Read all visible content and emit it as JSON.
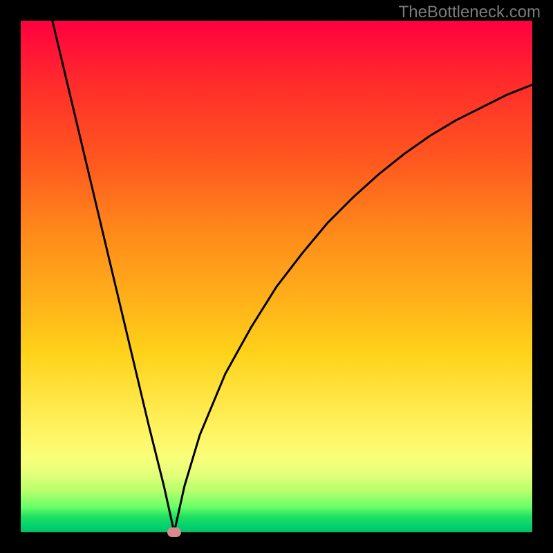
{
  "watermark": "TheBottleneck.com",
  "chart_data": {
    "type": "line",
    "title": "",
    "xlabel": "",
    "ylabel": "",
    "xlim": [
      0,
      1
    ],
    "ylim": [
      0,
      1
    ],
    "background": "red-to-green-vertical-gradient",
    "notch": {
      "x": 0.3,
      "y": 0.0
    },
    "series": [
      {
        "name": "curve",
        "x": [
          0.0,
          0.05,
          0.1,
          0.15,
          0.2,
          0.25,
          0.28,
          0.3,
          0.32,
          0.35,
          0.4,
          0.45,
          0.5,
          0.55,
          0.6,
          0.65,
          0.7,
          0.75,
          0.8,
          0.85,
          0.9,
          0.95,
          1.0
        ],
        "values": [
          1.26,
          1.05,
          0.84,
          0.63,
          0.42,
          0.21,
          0.09,
          0.0,
          0.09,
          0.19,
          0.31,
          0.4,
          0.48,
          0.545,
          0.605,
          0.655,
          0.7,
          0.74,
          0.775,
          0.805,
          0.83,
          0.855,
          0.875
        ]
      }
    ]
  },
  "colors": {
    "curve": "#000000",
    "dot": "#d98a8a",
    "frame": "#000000",
    "watermark": "#7a7a7a"
  }
}
